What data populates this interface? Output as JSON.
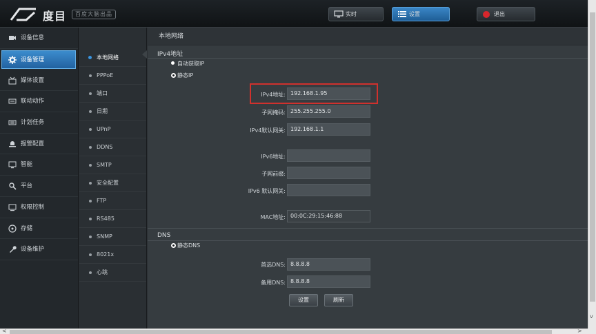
{
  "header": {
    "logo_text": "度目",
    "logo_sub": "百度大脑出品",
    "btn_live": "实时",
    "btn_settings": "设置",
    "btn_logout": "退出"
  },
  "leftnav": [
    {
      "label": "设备信息",
      "icon": "camera-icon"
    },
    {
      "label": "设备管理",
      "icon": "gear-icon"
    },
    {
      "label": "媒体设置",
      "icon": "media-icon"
    },
    {
      "label": "联动动作",
      "icon": "linkage-icon"
    },
    {
      "label": "计划任务",
      "icon": "schedule-icon"
    },
    {
      "label": "报警配置",
      "icon": "alarm-icon"
    },
    {
      "label": "智能",
      "icon": "monitor-icon"
    },
    {
      "label": "平台",
      "icon": "platform-icon"
    },
    {
      "label": "权限控制",
      "icon": "permission-icon"
    },
    {
      "label": "存储",
      "icon": "storage-icon"
    },
    {
      "label": "设备维护",
      "icon": "wrench-icon"
    }
  ],
  "active_leftnav": 1,
  "subnav": [
    "本地网络",
    "PPPoE",
    "端口",
    "日期",
    "UPnP",
    "DDNS",
    "SMTP",
    "安全配置",
    "FTP",
    "RS485",
    "SNMP",
    "8021x",
    "心跳"
  ],
  "active_subnav": 0,
  "main": {
    "breadcrumb": "本地网络",
    "ipv4_title": "IPv4地址",
    "radio_auto": "自动获取IP",
    "radio_static": "静态IP",
    "ipv4_addr_label": "IPv4地址:",
    "ipv4_addr_value": "192.168.1.95",
    "subnet_label": "子网掩码:",
    "subnet_value": "255.255.255.0",
    "gateway_label": "IPv4默认网关:",
    "gateway_value": "192.168.1.1",
    "ipv6_addr_label": "IPv6地址:",
    "ipv6_addr_value": "",
    "prefix_label": "子网前缀:",
    "prefix_value": "",
    "ipv6_gateway_label": "IPv6 默认网关:",
    "ipv6_gateway_value": "",
    "mac_label": "MAC地址:",
    "mac_value": "00:0C:29:15:46:88",
    "dns_title": "DNS",
    "radio_static_dns": "静态DNS",
    "dns1_label": "首选DNS:",
    "dns1_value": "8.8.8.8",
    "dns2_label": "备用DNS:",
    "dns2_value": "8.8.8.8",
    "btn_set": "设置",
    "btn_refresh": "刷新"
  },
  "scroll": {
    "left_arrow": "<",
    "right_arrow": ">",
    "down_arrow": "v"
  }
}
